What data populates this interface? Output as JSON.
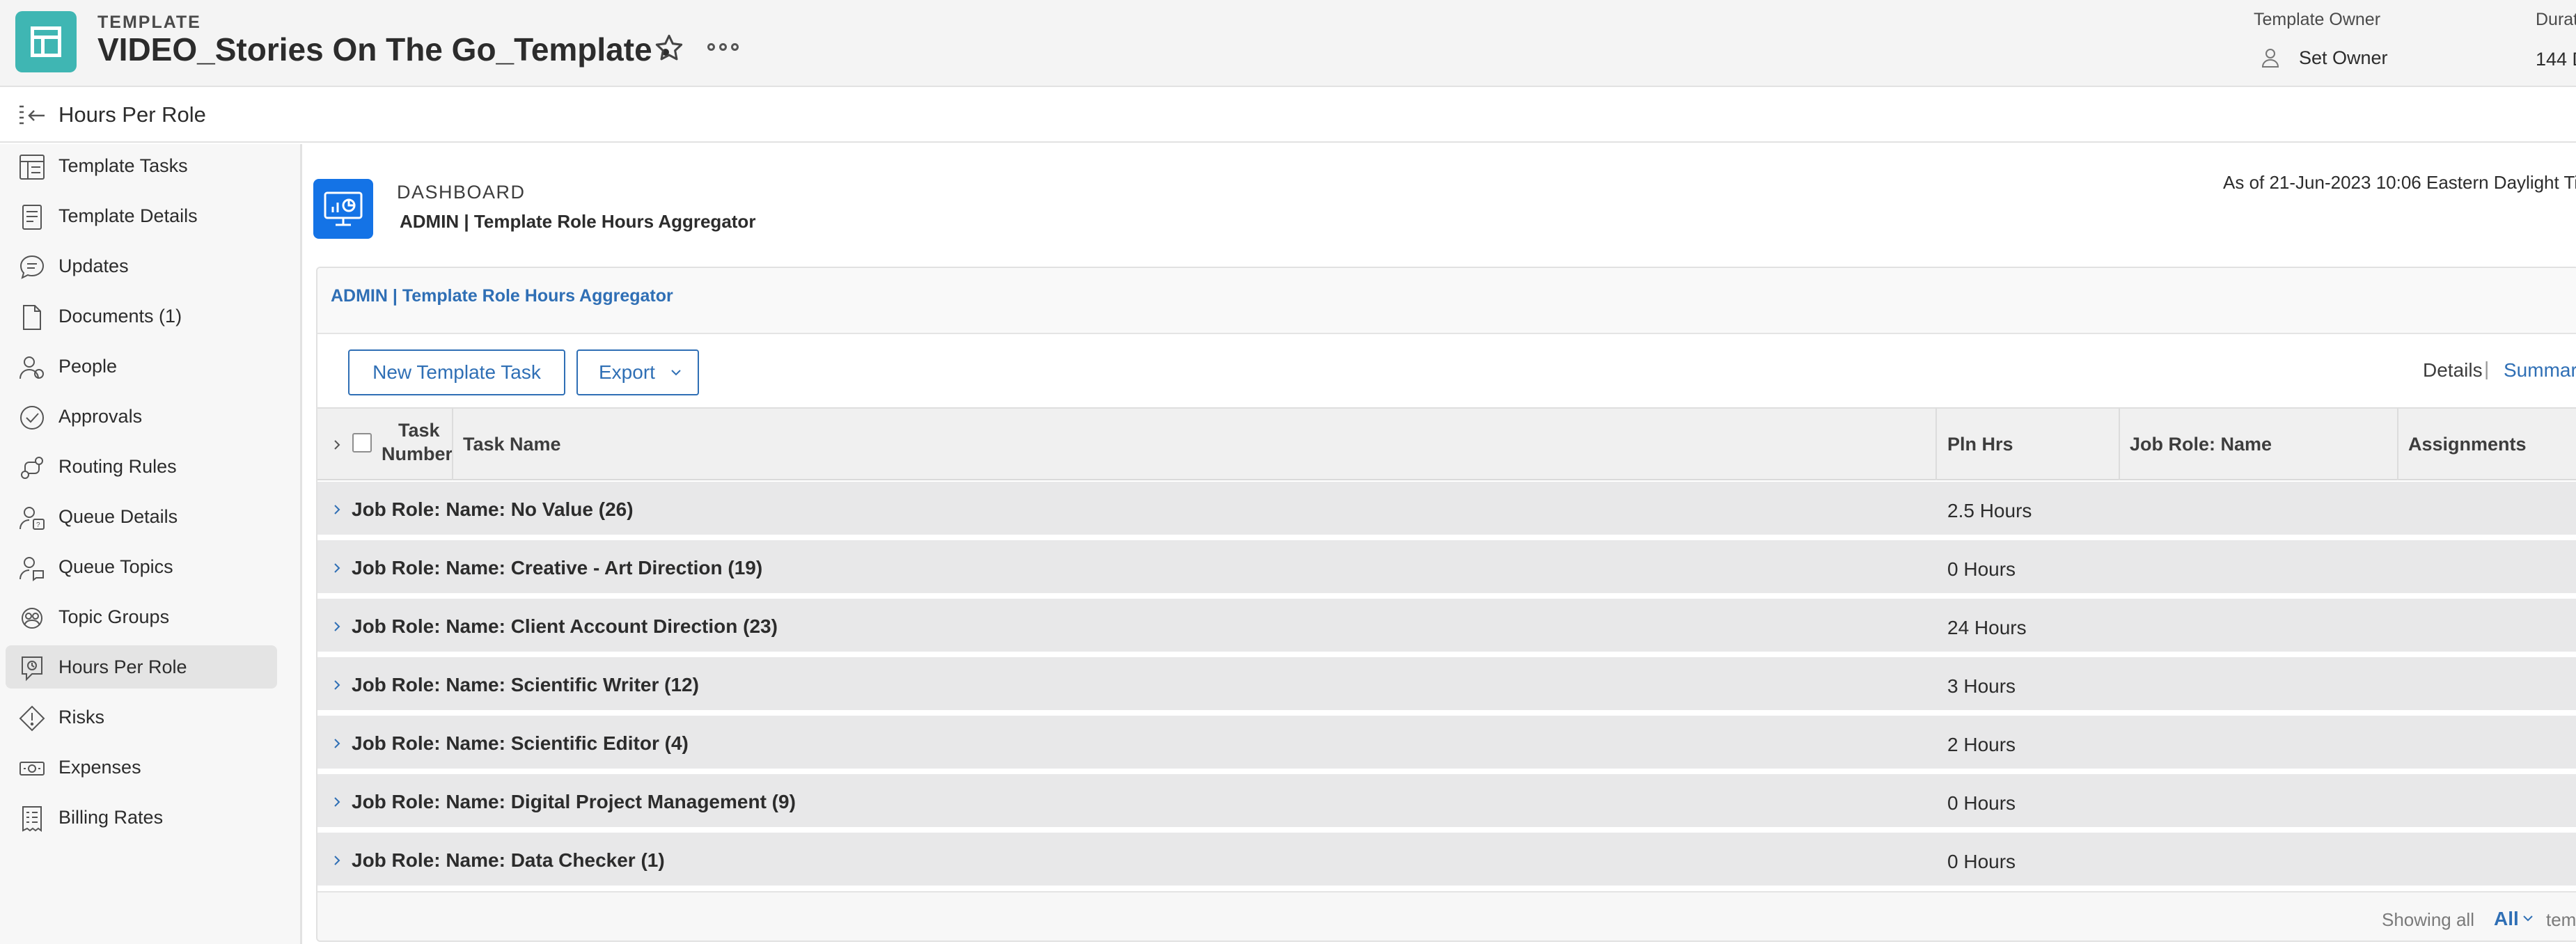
{
  "header": {
    "kicker": "TEMPLATE",
    "title": "VIDEO_Stories On The Go_Template",
    "owner_label": "Template Owner",
    "owner_value": "Set Owner",
    "duration_label": "Durat",
    "duration_value": "144 D",
    "icons": [
      "template-icon",
      "star-icon",
      "more-icon",
      "user-icon"
    ]
  },
  "subheader": {
    "title": "Hours Per Role",
    "icon": "collapse-panel-icon"
  },
  "sidebar": {
    "items": [
      {
        "label": "Template Tasks",
        "icon": "tasks-icon",
        "active": false
      },
      {
        "label": "Template Details",
        "icon": "document-icon",
        "active": false
      },
      {
        "label": "Updates",
        "icon": "chat-icon",
        "active": false
      },
      {
        "label": "Documents (1)",
        "icon": "file-icon",
        "active": false
      },
      {
        "label": "People",
        "icon": "people-icon",
        "active": false
      },
      {
        "label": "Approvals",
        "icon": "approval-icon",
        "active": false
      },
      {
        "label": "Routing Rules",
        "icon": "routing-icon",
        "active": false
      },
      {
        "label": "Queue Details",
        "icon": "queue-icon",
        "active": false
      },
      {
        "label": "Queue Topics",
        "icon": "queue-topics-icon",
        "active": false
      },
      {
        "label": "Topic Groups",
        "icon": "topic-groups-icon",
        "active": false
      },
      {
        "label": "Hours Per Role",
        "icon": "hours-role-icon",
        "active": true
      },
      {
        "label": "Risks",
        "icon": "risk-icon",
        "active": false
      },
      {
        "label": "Expenses",
        "icon": "expenses-icon",
        "active": false
      },
      {
        "label": "Billing Rates",
        "icon": "billing-icon",
        "active": false
      }
    ]
  },
  "dashboard": {
    "kicker": "DASHBOARD",
    "name": "ADMIN | Template Role Hours Aggregator",
    "as_of": "As of  21-Jun-2023 10:06 Eastern Daylight Ti",
    "icon": "dashboard-icon"
  },
  "report": {
    "title": "ADMIN | Template Role Hours Aggregator",
    "buttons": {
      "new_task": "New Template Task",
      "export": "Export"
    },
    "views": {
      "details": "Details",
      "separator": "|",
      "summary": "Summary"
    },
    "columns": {
      "task_number_1": "Task",
      "task_number_2": "Number",
      "task_name": "Task Name",
      "pln_hrs": "Pln Hrs",
      "job_role": "Job Role: Name",
      "assignments": "Assignments"
    },
    "groups": [
      {
        "label": "Job Role: Name: No Value (26)",
        "hours": "2.5 Hours"
      },
      {
        "label": "Job Role: Name: Creative - Art Direction (19)",
        "hours": "0 Hours"
      },
      {
        "label": "Job Role: Name: Client Account Direction (23)",
        "hours": "24 Hours"
      },
      {
        "label": "Job Role: Name: Scientific Writer (12)",
        "hours": "3 Hours"
      },
      {
        "label": "Job Role: Name: Scientific Editor (4)",
        "hours": "2 Hours"
      },
      {
        "label": "Job Role: Name: Digital Project Management (9)",
        "hours": "0 Hours"
      },
      {
        "label": "Job Role: Name: Data Checker (1)",
        "hours": "0 Hours"
      }
    ],
    "footer": {
      "showing": "Showing all",
      "all": "All",
      "extra": "templ"
    }
  },
  "colors": {
    "template_icon": "#3fb6b3",
    "dashboard_icon": "#1473e6",
    "link": "#2f6fb5",
    "row_bg": "#e8e8e9"
  }
}
